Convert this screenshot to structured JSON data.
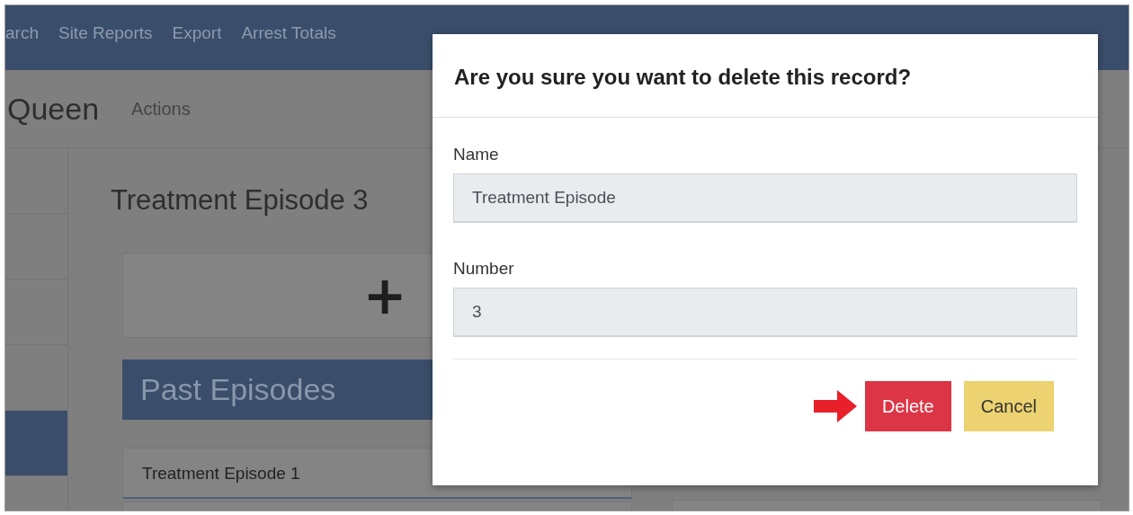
{
  "navbar": {
    "items": [
      {
        "label": "arch"
      },
      {
        "label": "Site Reports"
      },
      {
        "label": "Export"
      },
      {
        "label": "Arrest Totals"
      }
    ]
  },
  "page_header": {
    "title": "Queen",
    "actions": "Actions"
  },
  "sidebar": {
    "items": [
      {
        "selected": false
      },
      {
        "selected": false
      },
      {
        "selected": false
      },
      {
        "selected": false
      },
      {
        "selected": true
      }
    ]
  },
  "content": {
    "heading": "Treatment Episode 3",
    "add_label": "+",
    "section_title": "Past Episodes",
    "episodes": [
      {
        "name": "Treatment Episode 1"
      }
    ]
  },
  "dialog": {
    "title": "Are you sure you want to delete this record?",
    "fields": [
      {
        "label": "Name",
        "value": "Treatment Episode"
      },
      {
        "label": "Number",
        "value": "3"
      }
    ],
    "footer_items": [
      {
        "kind": "arrow"
      },
      {
        "kind": "danger",
        "label": "Delete"
      },
      {
        "kind": "warning",
        "label": "Cancel"
      }
    ]
  }
}
